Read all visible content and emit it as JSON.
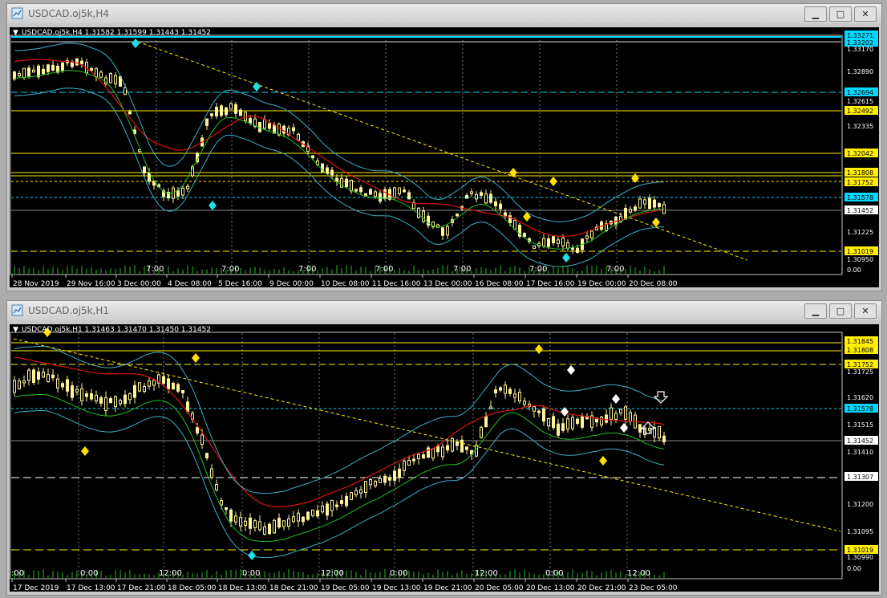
{
  "top": {
    "window_title": "USDCAD.oj5k,H4",
    "info_line": "USDCAD.oj5k,H4  1.31582 1.31599 1.31443 1.31452",
    "price_labels": [
      {
        "text": "1.33271",
        "style": "cyan"
      },
      {
        "text": "1.33202",
        "style": "cyan"
      },
      {
        "text": "1.33170",
        "style": "plain"
      },
      {
        "text": "1.32890",
        "style": "plain"
      },
      {
        "text": "1.32694",
        "style": "cyan"
      },
      {
        "text": "1.32615",
        "style": "plain"
      },
      {
        "text": "1.32492",
        "style": "yellow"
      },
      {
        "text": "1.32335",
        "style": "plain"
      },
      {
        "text": "1.32042",
        "style": "yellow"
      },
      {
        "text": "1.31808",
        "style": "yellow"
      },
      {
        "text": "1.31752",
        "style": "yellow"
      },
      {
        "text": "1.31578",
        "style": "cyan"
      },
      {
        "text": "1.31452",
        "style": "white"
      },
      {
        "text": "1.31225",
        "style": "plain"
      },
      {
        "text": "1.31019",
        "style": "yellow"
      },
      {
        "text": "1.30950",
        "style": "plain"
      },
      {
        "text": "0.00",
        "style": "plain"
      }
    ],
    "time_labels": [
      "28 Nov 2019",
      "29 Nov 16:00",
      "3 Dec 00:00",
      "4 Dec 08:00",
      "5 Dec 16:00",
      "9 Dec 00:00",
      "10 Dec 08:00",
      "11 Dec 16:00",
      "13 Dec 00:00",
      "16 Dec 08:00",
      "17 Dec 16:00",
      "19 Dec 00:00",
      "20 Dec 08:00"
    ],
    "session_labels": [
      "7:00",
      "7:00",
      "7:00",
      "7:00",
      "7:00",
      "7:00",
      "7:00"
    ]
  },
  "bottom": {
    "window_title": "USDCAD.oj5k,H1",
    "info_line": "USDCAD.oj5k,H1  1.31463 1.31470 1.31450 1.31452",
    "price_labels": [
      {
        "text": "1.31845",
        "style": "yellow"
      },
      {
        "text": "1.31808",
        "style": "yellow"
      },
      {
        "text": "1.31752",
        "style": "yellow"
      },
      {
        "text": "1.31725",
        "style": "plain"
      },
      {
        "text": "1.31620",
        "style": "plain"
      },
      {
        "text": "1.31578",
        "style": "cyan"
      },
      {
        "text": "1.31515",
        "style": "plain"
      },
      {
        "text": "1.31452",
        "style": "white"
      },
      {
        "text": "1.31410",
        "style": "plain"
      },
      {
        "text": "1.31307",
        "style": "white"
      },
      {
        "text": "1.31200",
        "style": "plain"
      },
      {
        "text": "1.31095",
        "style": "plain"
      },
      {
        "text": "1.31019",
        "style": "yellow"
      },
      {
        "text": "1.30990",
        "style": "plain"
      },
      {
        "text": "0.00",
        "style": "plain"
      }
    ],
    "time_labels": [
      "17 Dec 2019",
      "17 Dec 13:00",
      "17 Dec 21:00",
      "18 Dec 05:00",
      "18 Dec 13:00",
      "18 Dec 21:00",
      "19 Dec 05:00",
      "19 Dec 13:00",
      "19 Dec 21:00",
      "20 Dec 05:00",
      "20 Dec 13:00",
      "20 Dec 21:00",
      "23 Dec 05:00"
    ],
    "session_labels": [
      ":00",
      "0:00",
      "12:00",
      "0:00",
      "12:00",
      "0:00",
      "12:00",
      "0:00",
      "12:00"
    ]
  },
  "window_buttons": {
    "minimize": "▁",
    "maximize": "□",
    "close": "✕"
  },
  "colors": {
    "candle": "#fff39a",
    "ma_red": "#e01010",
    "ma_green": "#20c020",
    "bands": "#3ab0c8",
    "level_yellow": "#ffee00",
    "level_cyan": "#00d8ff",
    "bg": "#000000"
  }
}
